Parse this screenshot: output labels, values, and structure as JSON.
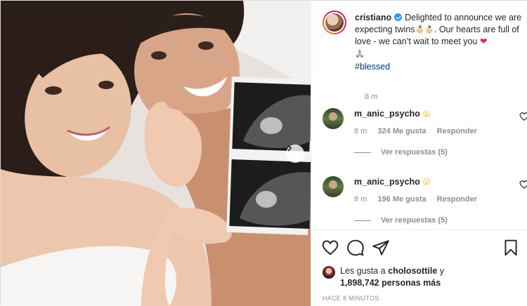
{
  "post": {
    "author": "cristiano",
    "caption_text": "Delighted to announce we are expecting twins",
    "caption_emoji_1": "👶🏻👶🏻",
    "caption_text_2": ". Our hearts are full of love - we can’t wait to meet you",
    "caption_heart": "❤",
    "caption_emoji_2": "🙏🏼",
    "hashtag": "#blessed",
    "caption_time": "8 m",
    "verified_icon": "verified-badge-icon"
  },
  "comments": [
    {
      "user": "m_anic_psycho",
      "emoji": "😮",
      "time": "8 m",
      "likes": "324 Me gusta",
      "reply_label": "Responder",
      "view_replies": "Ver respuestas (5)"
    },
    {
      "user": "m_anic_psycho",
      "emoji": "😮",
      "time": "8 m",
      "likes": "196 Me gusta",
      "reply_label": "Responder",
      "view_replies": "Ver respuestas (5)"
    }
  ],
  "likes": {
    "prefix": "Les gusta a",
    "liker": "cholosottile",
    "and": "y",
    "count": "1,898,742 personas más"
  },
  "post_time": "HACE 8 MINUTOS",
  "icons": {
    "like": "heart-outline-icon",
    "comment": "comment-bubble-icon",
    "share": "paper-plane-icon",
    "save": "bookmark-icon",
    "carousel": "chevron-right-icon"
  },
  "colors": {
    "link": "#00376b",
    "verified": "#3897f0",
    "secondary_text": "#8e8e8e",
    "border": "#dbdbdb"
  }
}
